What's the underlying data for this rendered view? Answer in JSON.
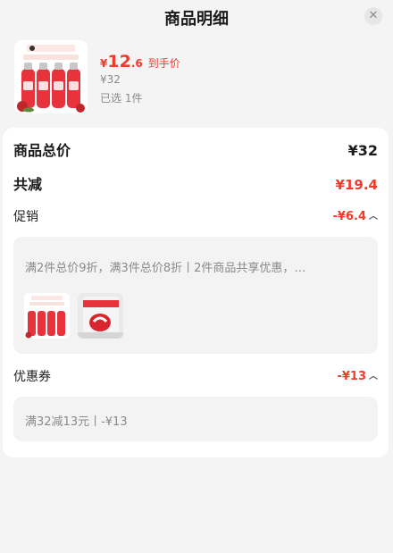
{
  "header": {
    "title": "商品明细",
    "close_icon": "close-icon"
  },
  "product": {
    "price_currency": "¥",
    "price_integer": "12",
    "price_decimal": ".6",
    "price_tag": "到手价",
    "original_price": "¥32",
    "selected": "已选 1件"
  },
  "summary": {
    "total_label": "商品总价",
    "total_value": "¥32",
    "discount_label": "共减",
    "discount_value": "¥19.4"
  },
  "promotion": {
    "label": "促销",
    "value": "-¥6.4",
    "description": "满2件总价9折，满3件总价8折丨2件商品共享优惠，…"
  },
  "coupon": {
    "label": "优惠券",
    "value": "-¥13",
    "description": "满32减13元丨-¥13"
  },
  "colors": {
    "accent": "#ef3b2c",
    "background": "#f4f4f4",
    "muted": "#8a8a8a"
  }
}
